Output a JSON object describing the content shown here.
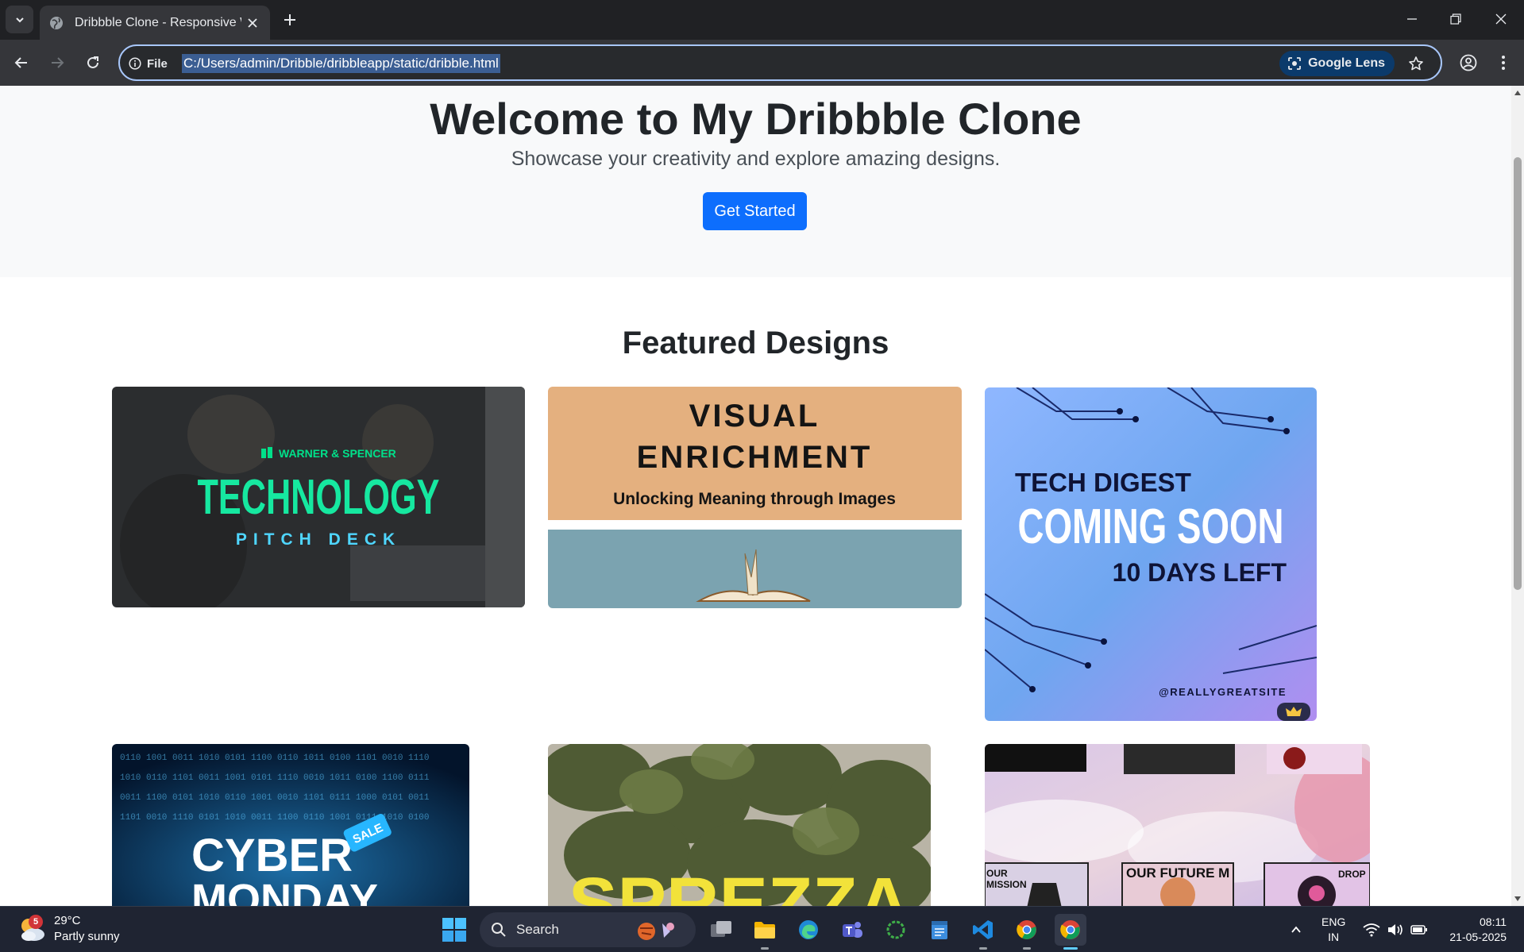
{
  "browser": {
    "tab_title": "Dribbble Clone - Responsive W",
    "site_info_label": "File",
    "url": "C:/Users/admin/Dribble/dribbleapp/static/dribble.html",
    "lens_label": "Google Lens"
  },
  "hero": {
    "title": "Welcome to My Dribbble Clone",
    "subtitle": "Showcase your creativity and explore amazing designs.",
    "cta_label": "Get Started"
  },
  "featured": {
    "title": "Featured Designs",
    "cards": [
      {
        "brand": "WARNER & SPENCER",
        "headline": "TECHNOLOGY",
        "sub": "PITCH DECK"
      },
      {
        "headline_1": "VISUAL",
        "headline_2": "ENRICHMENT",
        "sub": "Unlocking Meaning through Images"
      },
      {
        "line_1": "TECH DIGEST",
        "line_2": "COMING SOON",
        "line_3": "10 DAYS LEFT",
        "handle": "@REALLYGREATSITE"
      },
      {
        "line_1": "CYBER",
        "line_2": "MONDAY",
        "tag": "SALE"
      },
      {
        "headline": "SPREZZA"
      },
      {
        "label_1": "OUR",
        "label_2": "MISSION",
        "label_3": "OUR FUTURE M",
        "label_4": "DROP"
      }
    ]
  },
  "taskbar": {
    "weather_temp": "29°C",
    "weather_desc": "Partly sunny",
    "weather_badge": "5",
    "search_placeholder": "Search",
    "lang_1": "ENG",
    "lang_2": "IN",
    "time": "08:11",
    "date": "21-05-2025"
  },
  "colors": {
    "primary_button": "#0d6efd",
    "chrome_dark": "#202124",
    "hero_bg": "#f8f9fa"
  }
}
